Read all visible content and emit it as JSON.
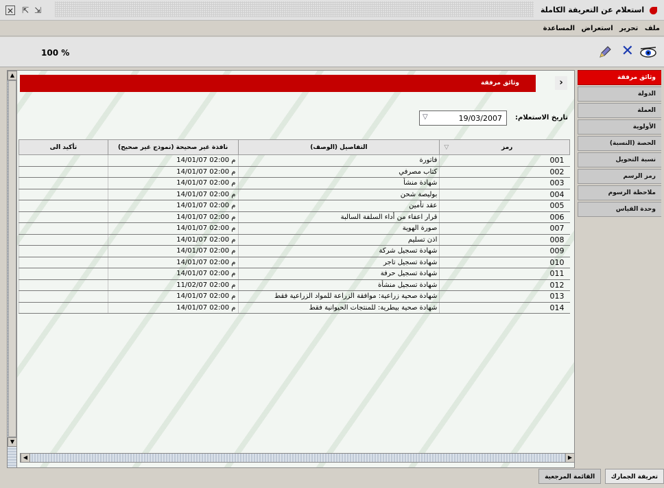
{
  "window": {
    "title": "استعلام عن التعريفة الكاملة"
  },
  "menu": [
    "ملف",
    "تحرير",
    "استعراض",
    "المساعدة"
  ],
  "toolbar": {
    "zoom": "100 %"
  },
  "sidebar": {
    "items": [
      {
        "label": "وثائق مرفقة",
        "active": true
      },
      {
        "label": "الدولة"
      },
      {
        "label": "العملة"
      },
      {
        "label": "الأولوية"
      },
      {
        "label": "الحصة (النسبة)"
      },
      {
        "label": "نسبة التحويل"
      },
      {
        "label": "رمز الرسم"
      },
      {
        "label": "ملاحظة الرسوم"
      },
      {
        "label": "وحدة القياس"
      }
    ]
  },
  "panel": {
    "title": "وثائق مرفقة",
    "date_label": "تاريخ الاستعلام:",
    "date_value": "19/03/2007"
  },
  "table": {
    "columns": {
      "code": "رمز",
      "desc": "التفاصيل (الوصف)",
      "window": "نافذة غير صحيحة (نموذج غير صحيح)",
      "confirm": "تأكيد الى"
    },
    "rows": [
      {
        "code": "001",
        "desc": "فاتورة",
        "window": "14/01/07 02:00 م"
      },
      {
        "code": "002",
        "desc": "كتاب مصرفي",
        "window": "14/01/07 02:00 م"
      },
      {
        "code": "003",
        "desc": "شهادة منشأ",
        "window": "14/01/07 02:00 م"
      },
      {
        "code": "004",
        "desc": "بوليصة شحن",
        "window": "14/01/07 02:00 م"
      },
      {
        "code": "005",
        "desc": "عقد تأمين",
        "window": "14/01/07 02:00 م"
      },
      {
        "code": "006",
        "desc": "قرار اعفاء من أداء السلفة السالبة",
        "window": "14/01/07 02:00 م"
      },
      {
        "code": "007",
        "desc": "صورة الهوية",
        "window": "14/01/07 02:00 م"
      },
      {
        "code": "008",
        "desc": "اذن تسليم",
        "window": "14/01/07 02:00 م"
      },
      {
        "code": "009",
        "desc": "شهادة تسجيل شركة",
        "window": "14/01/07 02:00 م"
      },
      {
        "code": "010",
        "desc": "شهادة تسجيل تاجر",
        "window": "14/01/07 02:00 م"
      },
      {
        "code": "011",
        "desc": "شهادة تسجيل حرفة",
        "window": "14/01/07 02:00 م"
      },
      {
        "code": "012",
        "desc": "شهادة تسجيل منشأة",
        "window": "11/02/07 02:00 م"
      },
      {
        "code": "013",
        "desc": "شهادة صحية زراعية: موافقة الزراعة للمواد الزراعية فقط",
        "window": "14/01/07 02:00 م"
      },
      {
        "code": "014",
        "desc": "شهادة صحية بيطرية: للمنتجات الحيوانية فقط",
        "window": "14/01/07 02:00 م"
      }
    ]
  },
  "bottom_tabs": [
    {
      "label": "تعريفة الجمارك",
      "active": true
    },
    {
      "label": "القائمة المرجعية"
    }
  ]
}
